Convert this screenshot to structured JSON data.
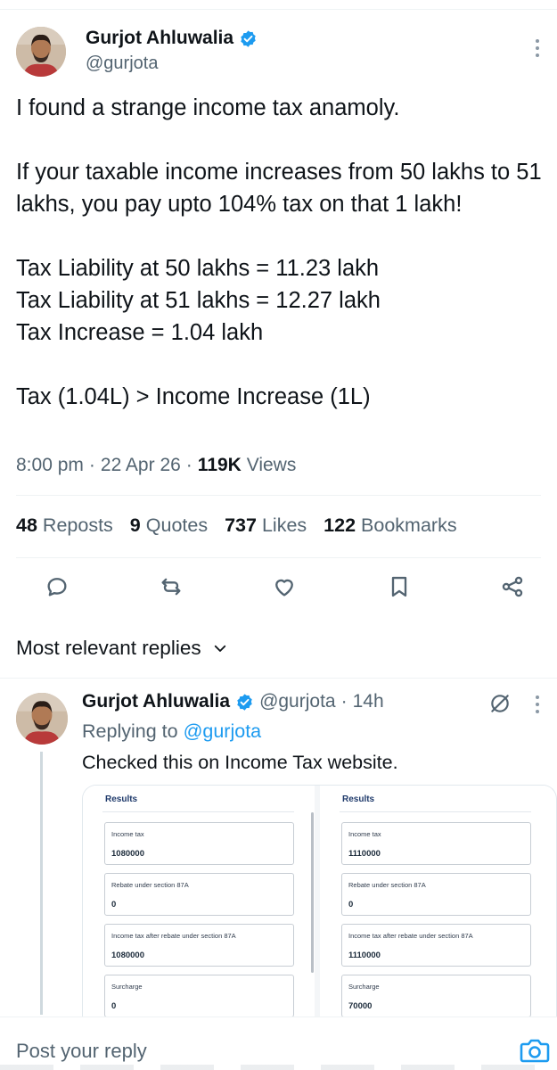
{
  "tweet": {
    "author": {
      "name": "Gurjot Ahluwalia",
      "handle": "@gurjota",
      "verified": true
    },
    "text": "I found a strange income tax anamoly.\n\nIf your taxable income increases from 50 lakhs to 51 lakhs, you pay upto 104% tax on that 1 lakh!\n\nTax Liability at 50 lakhs = 11.23 lakh\nTax Liability at 51 lakhs = 12.27 lakh\nTax Increase = 1.04 lakh\n\nTax (1.04L) > Income Increase (1L)",
    "time": "8:00 pm",
    "date": "22 Apr 26",
    "views_count": "119K",
    "views_label": "Views",
    "meta_separator": "·"
  },
  "stats": {
    "reposts_count": "48",
    "reposts_label": "Reposts",
    "quotes_count": "9",
    "quotes_label": "Quotes",
    "likes_count": "737",
    "likes_label": "Likes",
    "bookmarks_count": "122",
    "bookmarks_label": "Bookmarks"
  },
  "actions": [
    "reply-icon",
    "repost-icon",
    "like-icon",
    "bookmark-icon",
    "share-icon"
  ],
  "sort": {
    "label": "Most relevant replies"
  },
  "reply": {
    "author_name": "Gurjot Ahluwalia",
    "author_handle": "@gurjota",
    "separator": "·",
    "age": "14h",
    "replying_prefix": "Replying to",
    "replying_mention": "@gurjota",
    "text": "Checked this on Income Tax website.",
    "media": {
      "left_panel": {
        "title": "Results",
        "fields": [
          {
            "label": "Income tax",
            "value": "1080000"
          },
          {
            "label": "Rebate under section 87A",
            "value": "0"
          },
          {
            "label": "Income tax after rebate under section 87A",
            "value": "1080000"
          },
          {
            "label": "Surcharge",
            "value": "0"
          }
        ]
      },
      "right_panel": {
        "title": "Results",
        "fields": [
          {
            "label": "Income tax",
            "value": "1110000"
          },
          {
            "label": "Rebate under section 87A",
            "value": "0"
          },
          {
            "label": "Income tax after rebate under section 87A",
            "value": "1110000"
          },
          {
            "label": "Surcharge",
            "value": "70000"
          }
        ]
      }
    }
  },
  "composer": {
    "placeholder": "Post your reply"
  },
  "colors": {
    "text_primary": "#0f1419",
    "text_secondary": "#536471",
    "accent": "#1d9bf0",
    "divider": "#eff3f4"
  }
}
